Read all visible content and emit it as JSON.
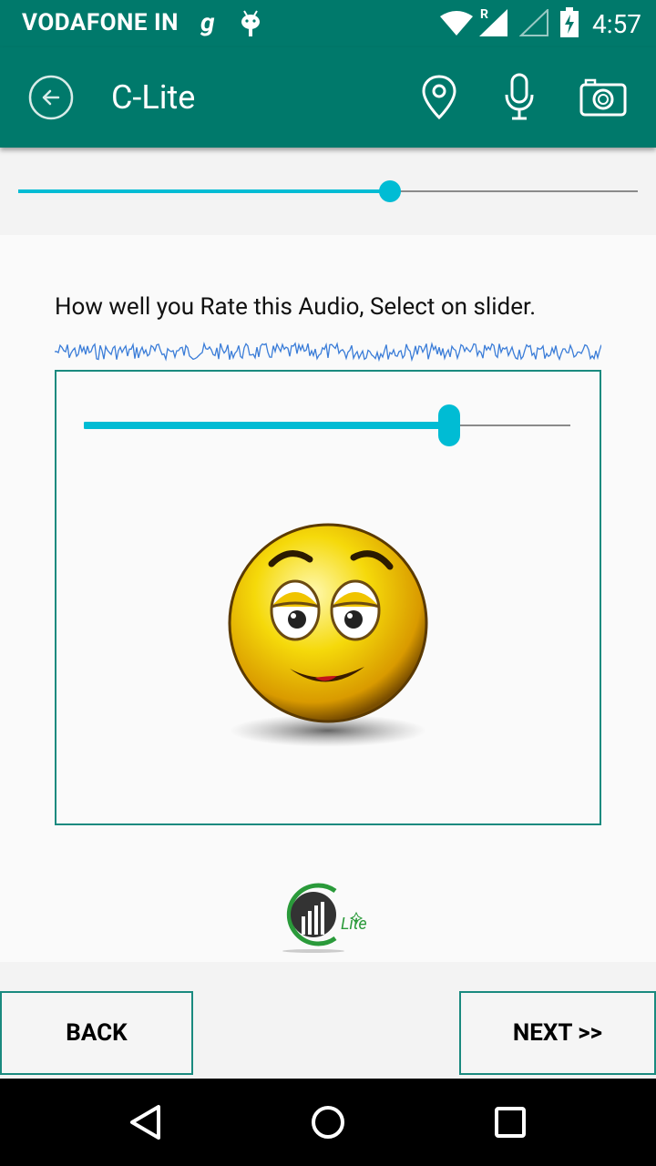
{
  "status_bar": {
    "carrier": "VODAFONE IN",
    "carrier_extra": "g",
    "time": "4:57",
    "icons": [
      "android-debug-icon",
      "wifi-icon",
      "signal-roaming-icon",
      "signal-empty-icon",
      "battery-charging-icon"
    ],
    "signal_label": "R"
  },
  "toolbar": {
    "title": "C-Lite",
    "icons": [
      "back-arrow-icon",
      "location-pin-icon",
      "microphone-icon",
      "camera-icon"
    ],
    "color": "#00796b"
  },
  "progress": {
    "value_percent": 60
  },
  "question": {
    "text": "How well you Rate this Audio, Select on slider."
  },
  "rating": {
    "slider_value_percent": 75,
    "emoji": "smiling-emoji-icon"
  },
  "logo": {
    "text": "Lite"
  },
  "buttons": {
    "back": "BACK",
    "next": "NEXT >>"
  },
  "navbar": {
    "icons": [
      "nav-back-icon",
      "nav-home-icon",
      "nav-recents-icon"
    ]
  },
  "colors": {
    "accent": "#00bcd4",
    "primary": "#00796b",
    "border": "#1a8a7f"
  }
}
